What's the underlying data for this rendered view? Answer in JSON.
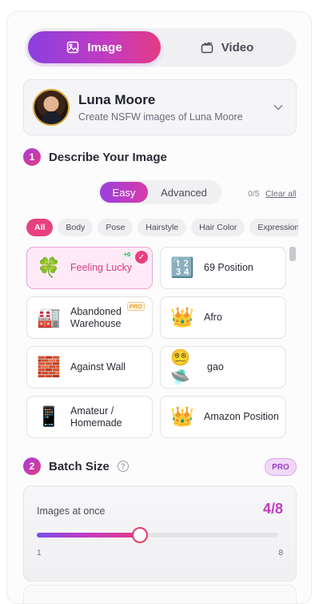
{
  "mode_toggle": {
    "image_label": "Image",
    "video_label": "Video",
    "active": "Image"
  },
  "model": {
    "name": "Luna Moore",
    "subtitle": "Create NSFW images of Luna Moore"
  },
  "describe": {
    "step": "1",
    "title": "Describe Your Image",
    "easy_label": "Easy",
    "advanced_label": "Advanced",
    "count": "0/5",
    "clear_label": "Clear all"
  },
  "chips": [
    {
      "label": "All",
      "active": true
    },
    {
      "label": "Body",
      "active": false
    },
    {
      "label": "Pose",
      "active": false
    },
    {
      "label": "Hairstyle",
      "active": false
    },
    {
      "label": "Hair Color",
      "active": false
    },
    {
      "label": "Expression",
      "active": false
    }
  ],
  "cards": [
    {
      "label": "Feeling Lucky",
      "icon": "four-leaf-clover-icon",
      "glyph": "🍀",
      "selected": true,
      "badge": "+0"
    },
    {
      "label": "69 Position",
      "icon": "number-keypad-icon",
      "glyph": "🔢",
      "selected": false
    },
    {
      "label": "Abandoned Warehouse",
      "icon": "factory-icon",
      "glyph": "🏭",
      "selected": false,
      "pro": "PRO"
    },
    {
      "label": "Afro",
      "icon": "crown-icon",
      "glyph": "👑",
      "selected": false
    },
    {
      "label": "Against Wall",
      "icon": "brick-wall-icon",
      "glyph": "🧱",
      "selected": false
    },
    {
      "label": "gao",
      "icon": "dizzy-face-icon",
      "glyph": "😵‍💫🛸",
      "selected": false
    },
    {
      "label": "Amateur / Homemade",
      "icon": "mobile-phone-icon",
      "glyph": "📱",
      "selected": false
    },
    {
      "label": "Amazon Position",
      "icon": "crown-icon",
      "glyph": "👑",
      "selected": false
    }
  ],
  "batch": {
    "step": "2",
    "title": "Batch Size",
    "pro_label": "PRO",
    "images_label": "Images at once",
    "value_text": "4/8",
    "value": 4,
    "min": 1,
    "max": 8,
    "min_label": "1",
    "max_label": "8"
  }
}
